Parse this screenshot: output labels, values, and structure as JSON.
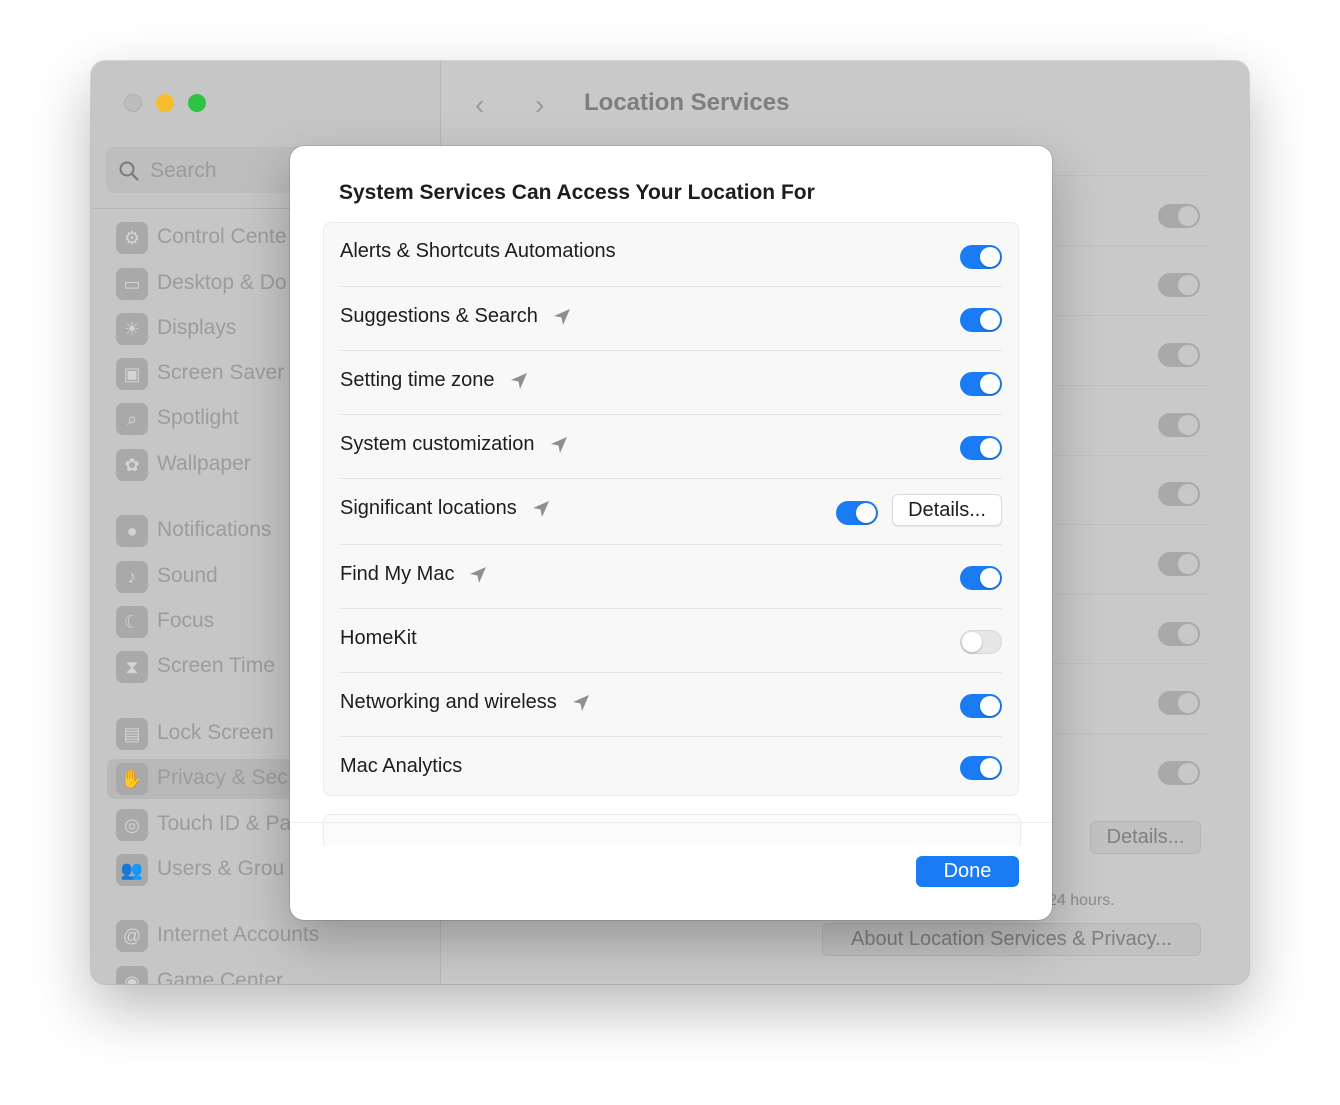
{
  "window": {
    "title": "Location Services",
    "back_label": "‹",
    "forward_label": "›"
  },
  "sidebar": {
    "search_placeholder": "Search",
    "items": [
      {
        "label": "Control Cente",
        "icon": "control-center-icon",
        "glyph": "⚙"
      },
      {
        "label": "Desktop & Do",
        "icon": "desktop-dock-icon",
        "glyph": "▭"
      },
      {
        "label": "Displays",
        "icon": "displays-icon",
        "glyph": "☀"
      },
      {
        "label": "Screen Saver",
        "icon": "screen-saver-icon",
        "glyph": "▣"
      },
      {
        "label": "Spotlight",
        "icon": "spotlight-icon",
        "glyph": "⌕"
      },
      {
        "label": "Wallpaper",
        "icon": "wallpaper-icon",
        "glyph": "✿"
      },
      {
        "label": "Notifications",
        "icon": "notifications-icon",
        "glyph": "●"
      },
      {
        "label": "Sound",
        "icon": "sound-icon",
        "glyph": "♪"
      },
      {
        "label": "Focus",
        "icon": "focus-icon",
        "glyph": "☾"
      },
      {
        "label": "Screen Time",
        "icon": "screen-time-icon",
        "glyph": "⧗"
      },
      {
        "label": "Lock Screen",
        "icon": "lock-screen-icon",
        "glyph": "▤"
      },
      {
        "label": "Privacy & Sec",
        "icon": "privacy-hand-icon",
        "glyph": "✋"
      },
      {
        "label": "Touch ID & Pa",
        "icon": "touch-id-icon",
        "glyph": "◎"
      },
      {
        "label": "Users & Grou",
        "icon": "users-groups-icon",
        "glyph": "👥"
      },
      {
        "label": "Internet Accounts",
        "icon": "internet-accounts-icon",
        "glyph": "@"
      },
      {
        "label": "Game Center",
        "icon": "game-center-icon",
        "glyph": "◉"
      }
    ]
  },
  "background": {
    "details_label": "Details...",
    "note_fragment": "24 hours.",
    "about_label": "About Location Services & Privacy..."
  },
  "sheet": {
    "title": "System Services Can Access Your Location For",
    "rows": [
      {
        "label": "Alerts & Shortcuts Automations",
        "on": true,
        "arrow": false
      },
      {
        "label": "Suggestions & Search",
        "on": true,
        "arrow": true
      },
      {
        "label": "Setting time zone",
        "on": true,
        "arrow": true
      },
      {
        "label": "System customization",
        "on": true,
        "arrow": true
      },
      {
        "label": "Significant locations",
        "on": true,
        "arrow": true,
        "details": "Details..."
      },
      {
        "label": "Find My Mac",
        "on": true,
        "arrow": true
      },
      {
        "label": "HomeKit",
        "on": false,
        "arrow": false
      },
      {
        "label": "Networking and wireless",
        "on": true,
        "arrow": true
      },
      {
        "label": "Mac Analytics",
        "on": true,
        "arrow": false
      }
    ],
    "done_label": "Done"
  },
  "colors": {
    "accent": "#1a7cf5",
    "toggle_off": "#e7e7e7"
  }
}
